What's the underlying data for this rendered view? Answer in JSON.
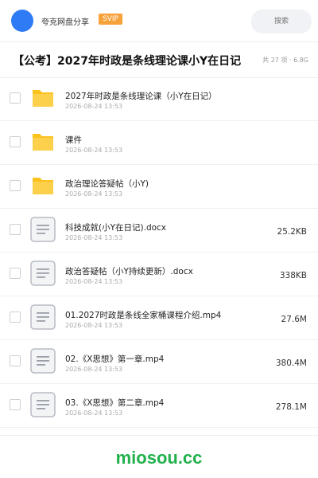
{
  "header": {
    "brand": "夸克网盘分享",
    "badge": "SVIP",
    "search_label": "搜索"
  },
  "title_bar": {
    "title": "【公考】2027年时政是条线理论课小Y在日记",
    "count": "共 27 项 · 6.8G"
  },
  "items": [
    {
      "name": "2027年时政是条线理论课（小Y在日记）",
      "date": "2026-08-24 13:53",
      "size": "",
      "type": "folder"
    },
    {
      "name": "课件",
      "date": "2026-08-24 13:53",
      "size": "",
      "type": "folder"
    },
    {
      "name": "政治理论答疑帖（小Y)",
      "date": "2026-08-24 13:53",
      "size": "",
      "type": "folder"
    },
    {
      "name": "科技成就(小Y在日记).docx",
      "date": "2026-08-24 13:53",
      "size": "25.2KB",
      "type": "file"
    },
    {
      "name": "政治答疑帖（小Y持续更新）.docx",
      "date": "2026-08-24 13:53",
      "size": "338KB",
      "type": "file"
    },
    {
      "name": "01.2027时政是条线全家桶课程介绍.mp4",
      "date": "2026-08-24 13:53",
      "size": "27.6M",
      "type": "file"
    },
    {
      "name": "02.《X思想》第一章.mp4",
      "date": "2026-08-24 13:53",
      "size": "380.4M",
      "type": "file"
    },
    {
      "name": "03.《X思想》第二章.mp4",
      "date": "2026-08-24 13:53",
      "size": "278.1M",
      "type": "file"
    }
  ],
  "watermark": "miosou.cc",
  "colors": {
    "accent": "#2f7bf6",
    "badge": "#f7a23b",
    "folder": "#fbc11c",
    "watermark": "#22b14c"
  }
}
